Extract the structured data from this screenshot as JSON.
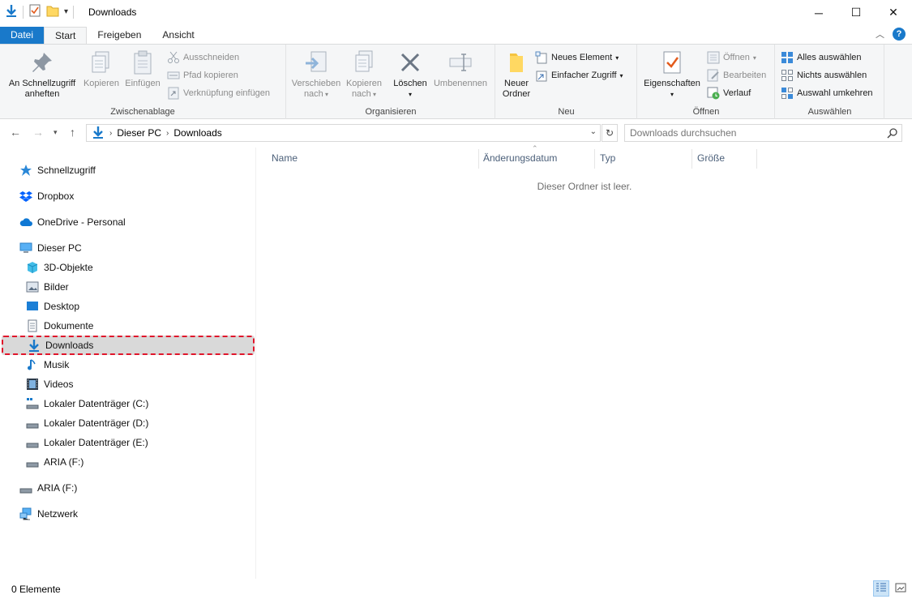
{
  "window": {
    "title": "Downloads",
    "minimize_label": "─",
    "maximize_label": "☐",
    "close_label": "✕"
  },
  "tabs": {
    "file": "Datei",
    "start": "Start",
    "share": "Freigeben",
    "view": "Ansicht"
  },
  "ribbon": {
    "clipboard": {
      "label": "Zwischenablage",
      "pin": "An Schnellzugriff anheften",
      "copy": "Kopieren",
      "paste": "Einfügen",
      "cut": "Ausschneiden",
      "copy_path": "Pfad kopieren",
      "paste_shortcut": "Verknüpfung einfügen"
    },
    "organize": {
      "label": "Organisieren",
      "move_to": "Verschieben nach",
      "copy_to": "Kopieren nach",
      "delete": "Löschen",
      "rename": "Umbenennen"
    },
    "new": {
      "label": "Neu",
      "new_folder": "Neuer Ordner",
      "new_item": "Neues Element",
      "easy_access": "Einfacher Zugriff"
    },
    "open": {
      "label": "Öffnen",
      "properties": "Eigenschaften",
      "open": "Öffnen",
      "edit": "Bearbeiten",
      "history": "Verlauf"
    },
    "select": {
      "label": "Auswählen",
      "select_all": "Alles auswählen",
      "select_none": "Nichts auswählen",
      "invert": "Auswahl umkehren"
    }
  },
  "address": {
    "crumbs": [
      "Dieser PC",
      "Downloads"
    ],
    "search_placeholder": "Downloads durchsuchen"
  },
  "sidebar": {
    "items": [
      {
        "label": "Schnellzugriff",
        "icon": "star-icon"
      },
      {
        "label": "Dropbox",
        "icon": "dropbox-icon"
      },
      {
        "label": "OneDrive - Personal",
        "icon": "cloud-icon"
      },
      {
        "label": "Dieser PC",
        "icon": "computer-icon"
      },
      {
        "label": "3D-Objekte",
        "icon": "cube-icon"
      },
      {
        "label": "Bilder",
        "icon": "picture-icon"
      },
      {
        "label": "Desktop",
        "icon": "desktop-icon"
      },
      {
        "label": "Dokumente",
        "icon": "document-icon"
      },
      {
        "label": "Downloads",
        "icon": "download-icon"
      },
      {
        "label": "Musik",
        "icon": "music-icon"
      },
      {
        "label": "Videos",
        "icon": "video-icon"
      },
      {
        "label": "Lokaler Datenträger (C:)",
        "icon": "drive-icon"
      },
      {
        "label": "Lokaler Datenträger (D:)",
        "icon": "drive-icon"
      },
      {
        "label": "Lokaler Datenträger (E:)",
        "icon": "drive-icon"
      },
      {
        "label": "ARIA (F:)",
        "icon": "drive-icon"
      },
      {
        "label": "ARIA (F:)",
        "icon": "drive-icon"
      },
      {
        "label": "Netzwerk",
        "icon": "network-icon"
      }
    ]
  },
  "content": {
    "columns": [
      "Name",
      "Änderungsdatum",
      "Typ",
      "Größe"
    ],
    "empty_message": "Dieser Ordner ist leer."
  },
  "status": {
    "count": "0 Elemente"
  },
  "colors": {
    "accent": "#1979ca",
    "selection_border": "#e0162b",
    "selection_bg": "#d9d9d9"
  }
}
